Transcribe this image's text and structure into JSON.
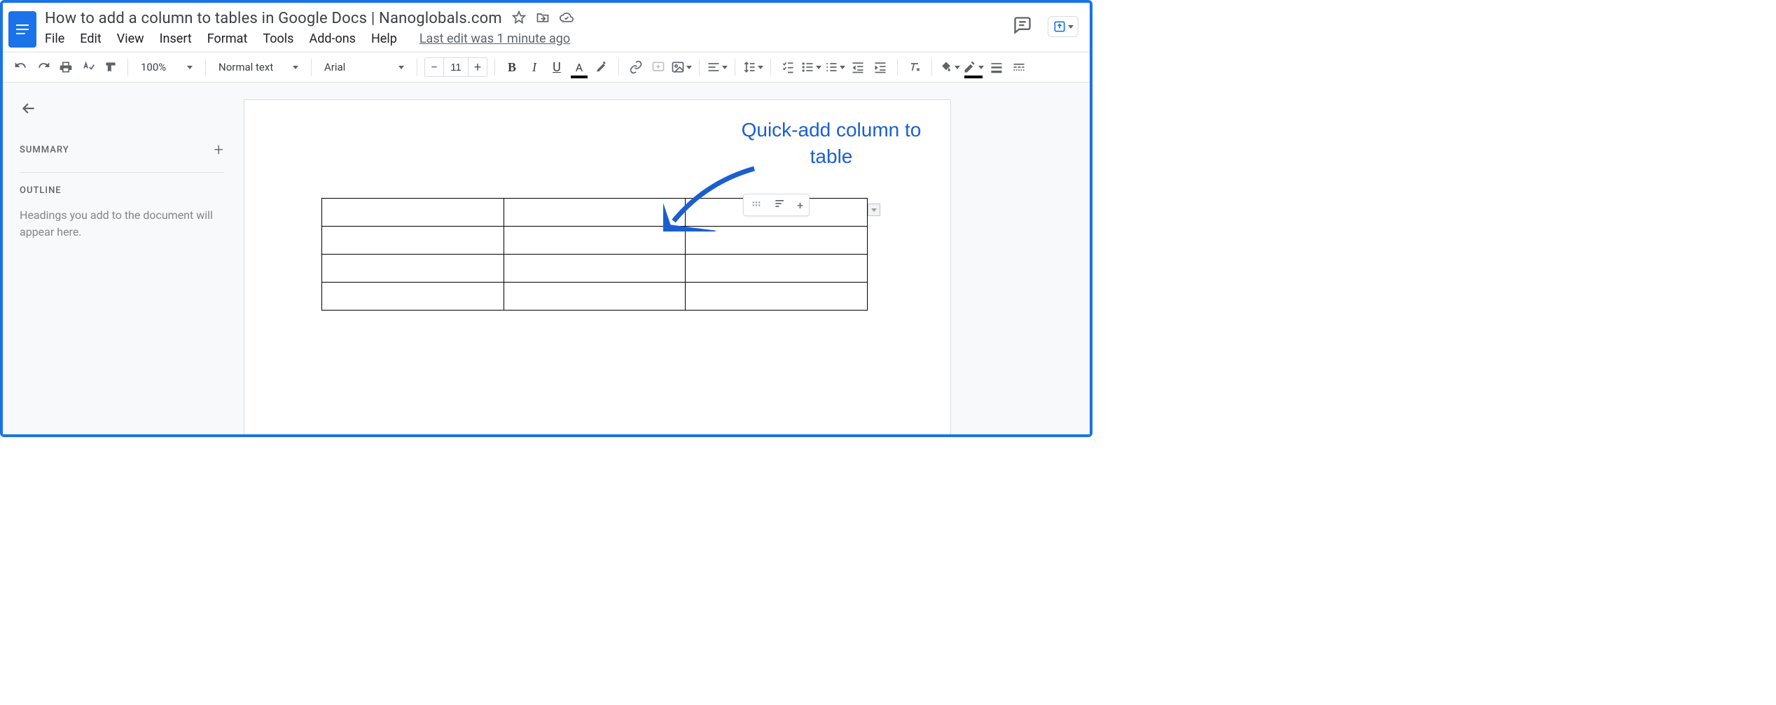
{
  "header": {
    "doc_title": "How to add a column to tables in Google Docs | Nanoglobals.com",
    "last_edit": "Last edit was 1 minute ago"
  },
  "menu": {
    "file": "File",
    "edit": "Edit",
    "view": "View",
    "insert": "Insert",
    "format": "Format",
    "tools": "Tools",
    "addons": "Add-ons",
    "help": "Help"
  },
  "toolbar": {
    "zoom": "100%",
    "style": "Normal text",
    "font": "Arial",
    "font_size": "11"
  },
  "sidebar": {
    "summary_label": "SUMMARY",
    "outline_label": "OUTLINE",
    "outline_placeholder": "Headings you add to the document will appear here."
  },
  "document": {
    "table": {
      "rows": 4,
      "cols": 3
    }
  },
  "annotation": {
    "text": "Quick-add column to table"
  }
}
